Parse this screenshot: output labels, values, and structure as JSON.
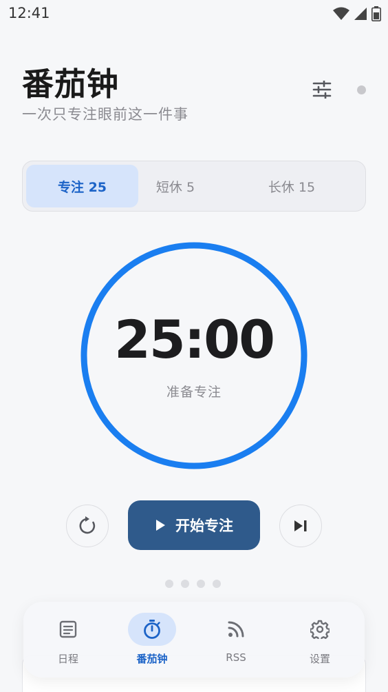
{
  "status_bar": {
    "time": "12:41"
  },
  "header": {
    "title": "番茄钟",
    "subtitle": "一次只专注眼前这一件事"
  },
  "mode_tabs": [
    {
      "label": "专注 25",
      "active": true
    },
    {
      "label": "短休 5",
      "active": false
    },
    {
      "label": "长休 15",
      "active": false
    }
  ],
  "timer": {
    "display": "25:00",
    "status": "准备专注",
    "progress": 1.0
  },
  "controls": {
    "start_label": "开始专注"
  },
  "nav": [
    {
      "label": "日程",
      "icon": "article-icon",
      "active": false
    },
    {
      "label": "番茄钟",
      "icon": "timer-icon",
      "active": true
    },
    {
      "label": "RSS",
      "icon": "rss-icon",
      "active": false
    },
    {
      "label": "设置",
      "icon": "gear-icon",
      "active": false
    }
  ],
  "colors": {
    "accent": "#1a7ef0",
    "primary_button": "#2f5a8b",
    "active_tab_bg": "#d6e4fb",
    "active_text": "#1c63c7"
  }
}
